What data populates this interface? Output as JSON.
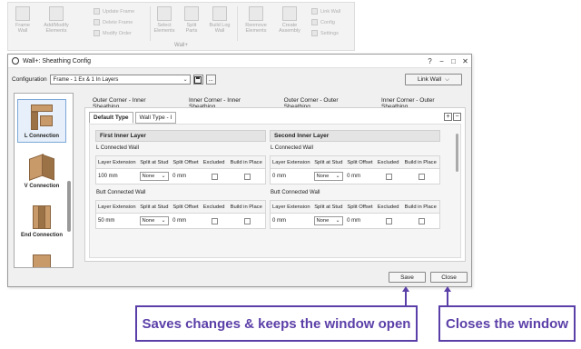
{
  "ribbon": {
    "groups": [
      {
        "label": "Frame Wall"
      },
      {
        "label": "Add/Modify Elements"
      },
      {
        "label": "Select Elements"
      },
      {
        "label": "Split Parts"
      },
      {
        "label": "Build Log Wall"
      },
      {
        "label": "Renmove Elements"
      },
      {
        "label": "Create Assembly"
      }
    ],
    "small": [
      {
        "label": "Update Frame"
      },
      {
        "label": "Delete Frame"
      },
      {
        "label": "Modify Order"
      },
      {
        "label": "Link Wall"
      },
      {
        "label": "Config"
      },
      {
        "label": "Settings"
      }
    ],
    "footer": "Wall+"
  },
  "window": {
    "title": "Wall+: Sheathing Config",
    "controls": {
      "help": "?",
      "minimize": "−",
      "maximize": "□",
      "close": "✕"
    }
  },
  "config": {
    "label": "Configuration",
    "selected": "Frame - 1 Ex & 1 In Layers",
    "more_label": "...",
    "link_wall_label": "Link Wall"
  },
  "connections": [
    {
      "label": "L Connection"
    },
    {
      "label": "V Connection"
    },
    {
      "label": "End Connection"
    }
  ],
  "outer_tabs": [
    {
      "label": "Outer Corner - Inner Sheathing"
    },
    {
      "label": "Inner Corner - Inner Sheathing"
    },
    {
      "label": "Outer Corner - Outer Sheathing"
    },
    {
      "label": "Inner Corner - Outer Sheathing"
    }
  ],
  "inner_tabs": [
    {
      "label": "Default Type"
    },
    {
      "label": "Wall Type - I"
    }
  ],
  "columns": [
    "Layer Extension",
    "Split at Stud",
    "Split Offset",
    "Excluded",
    "Build in Place"
  ],
  "layers": [
    {
      "title": "First Inner Layer",
      "sections": [
        {
          "label": "L Connected Wall",
          "row": {
            "extension": "100 mm",
            "split": "None",
            "offset": "0 mm"
          }
        },
        {
          "label": "Butt Connected Wall",
          "row": {
            "extension": "50 mm",
            "split": "None",
            "offset": "0 mm"
          }
        }
      ]
    },
    {
      "title": "Second Inner Layer",
      "sections": [
        {
          "label": "L Connected Wall",
          "row": {
            "extension": "0 mm",
            "split": "None",
            "offset": "0 mm"
          }
        },
        {
          "label": "Butt Connected Wall",
          "row": {
            "extension": "0 mm",
            "split": "None",
            "offset": "0 mm"
          }
        }
      ]
    }
  ],
  "buttons": {
    "save": "Save",
    "close": "Close"
  },
  "annotations": {
    "save": "Saves changes & keeps the window open",
    "close": "Closes the window",
    "color": "#5b3fa8"
  }
}
